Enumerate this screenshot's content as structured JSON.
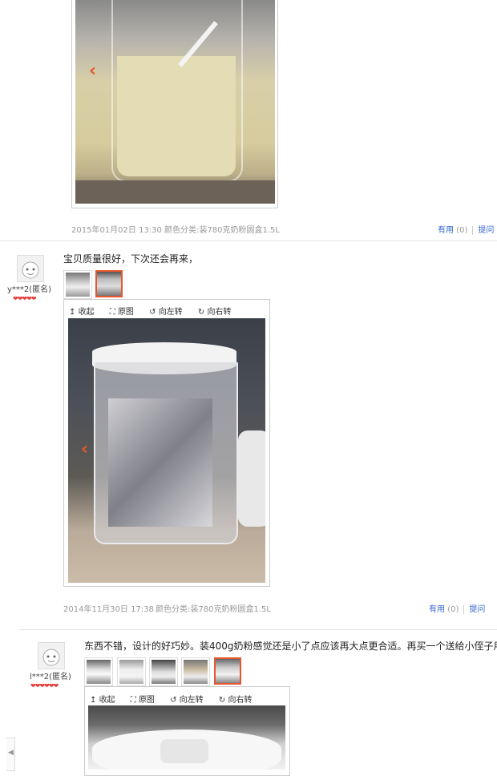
{
  "viewer_tools": {
    "collapse": "收起",
    "original": "原图",
    "rotate_left": "向左转",
    "rotate_right": "向右转"
  },
  "reviews": [
    {
      "date": "2015年01月02日 13:30",
      "spec": "颜色分类:装780克奶粉圆盒1.5L",
      "useful_label": "有用",
      "useful_count": "(0)",
      "ask_label": "提问"
    },
    {
      "user": "y***2(匿名)",
      "text": "宝贝质量很好，下次还会再来，",
      "date": "2014年11月30日 17:38",
      "spec": "颜色分类:装780克奶粉圆盒1.5L",
      "useful_label": "有用",
      "useful_count": "(0)",
      "ask_label": "提问"
    },
    {
      "user": "l***2(匿名)",
      "text": "东西不错，设计的好巧妙。装400g奶粉感觉还是小了点应该再大点更合适。再买一个送给小侄子用。"
    }
  ],
  "icons": {
    "prev": "chevron-left-icon",
    "hearts": "heart-rating-icon"
  }
}
